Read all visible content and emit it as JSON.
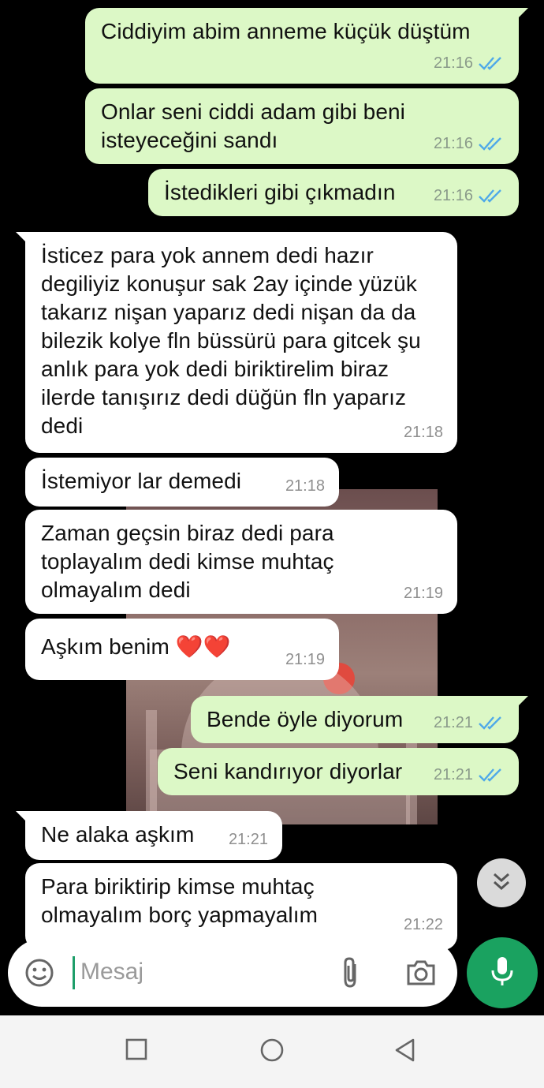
{
  "colors": {
    "outgoing_bubble": "#dcf8c6",
    "incoming_bubble": "#ffffff",
    "read_ticks": "#4fa9e8",
    "mic_button": "#1aa260",
    "background": "#000000"
  },
  "messages": [
    {
      "direction": "out",
      "text": "Ciddiyim abim anneme küçük düştüm",
      "time": "21:16",
      "status": "read"
    },
    {
      "direction": "out",
      "text": "Onlar seni ciddi adam gibi beni isteyeceğini sandı",
      "time": "21:16",
      "status": "read"
    },
    {
      "direction": "out",
      "text": "İstedikleri gibi çıkmadın",
      "time": "21:16",
      "status": "read"
    },
    {
      "direction": "in",
      "text": "İsticez para yok annem dedi hazır degiliyiz konuşur sak 2ay içinde yüzük takarız nişan yaparız dedi nişan da da bilezik kolye fln büssürü para gitcek şu anlık para yok dedi biriktirelim biraz ilerde tanışırız dedi düğün fln yaparız dedi",
      "time": "21:18"
    },
    {
      "direction": "in",
      "text": "İstemiyor lar demedi",
      "time": "21:18"
    },
    {
      "direction": "in",
      "text": "Zaman geçsin biraz dedi para toplayalım dedi kimse muhtaç olmayalım dedi",
      "time": "21:19"
    },
    {
      "direction": "in",
      "text": "Aşkım benim ❤️❤️",
      "time": "21:19"
    },
    {
      "direction": "out",
      "text": "Bende öyle diyorum",
      "time": "21:21",
      "status": "read"
    },
    {
      "direction": "out",
      "text": "Seni kandırıyor diyorlar",
      "time": "21:21",
      "status": "read"
    },
    {
      "direction": "in",
      "text": "Ne alaka aşkım",
      "time": "21:21"
    },
    {
      "direction": "in",
      "text": "Para biriktirip kimse muhtaç olmayalım borç yapmayalım",
      "time": "21:22"
    }
  ],
  "composer": {
    "placeholder": "Mesaj",
    "icons": [
      "emoji-icon",
      "attach-icon",
      "camera-icon",
      "mic-icon"
    ]
  },
  "scroll_down_icon": "double-chevron-down-icon",
  "nav_icons": [
    "recents-icon",
    "home-icon",
    "back-icon"
  ]
}
